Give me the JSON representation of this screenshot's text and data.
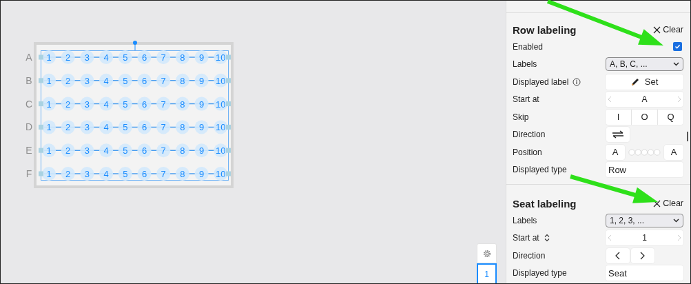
{
  "canvas": {
    "rows": [
      {
        "label": "A",
        "seats": [
          "1",
          "2",
          "3",
          "4",
          "5",
          "6",
          "7",
          "8",
          "9",
          "10"
        ]
      },
      {
        "label": "B",
        "seats": [
          "1",
          "2",
          "3",
          "4",
          "5",
          "6",
          "7",
          "8",
          "9",
          "10"
        ]
      },
      {
        "label": "C",
        "seats": [
          "1",
          "2",
          "3",
          "4",
          "5",
          "6",
          "7",
          "8",
          "9",
          "10"
        ]
      },
      {
        "label": "D",
        "seats": [
          "1",
          "2",
          "3",
          "4",
          "5",
          "6",
          "7",
          "8",
          "9",
          "10"
        ]
      },
      {
        "label": "E",
        "seats": [
          "1",
          "2",
          "3",
          "4",
          "5",
          "6",
          "7",
          "8",
          "9",
          "10"
        ]
      },
      {
        "label": "F",
        "seats": [
          "1",
          "2",
          "3",
          "4",
          "5",
          "6",
          "7",
          "8",
          "9",
          "10"
        ]
      }
    ]
  },
  "panel": {
    "sections": [
      {
        "title": "Row labeling",
        "clear": "Clear",
        "fields": [
          {
            "label": "Enabled",
            "kind": "checkbox",
            "checked": true
          },
          {
            "label": "Labels",
            "kind": "select",
            "value": "A, B, C, ..."
          },
          {
            "label": "Displayed label",
            "kind": "button",
            "value": "Set"
          },
          {
            "label": "Start at",
            "kind": "stepper",
            "value": "A"
          },
          {
            "label": "Skip",
            "kind": "segments",
            "options": [
              "I",
              "O",
              "Q"
            ]
          },
          {
            "label": "Direction",
            "kind": "swap"
          },
          {
            "label": "Position",
            "kind": "position",
            "start": "A",
            "end": "A"
          },
          {
            "label": "Displayed type",
            "kind": "text",
            "value": "Row"
          }
        ]
      },
      {
        "title": "Seat labeling",
        "clear": "Clear",
        "fields": [
          {
            "label": "Labels",
            "kind": "select",
            "value": "1, 2, 3, ..."
          },
          {
            "label": "Start at",
            "kind": "stepper",
            "value": "1"
          },
          {
            "label": "Direction",
            "kind": "arrows"
          },
          {
            "label": "Displayed type",
            "kind": "text",
            "value": "Seat"
          }
        ]
      }
    ]
  },
  "view_controls": {
    "page": "1"
  }
}
